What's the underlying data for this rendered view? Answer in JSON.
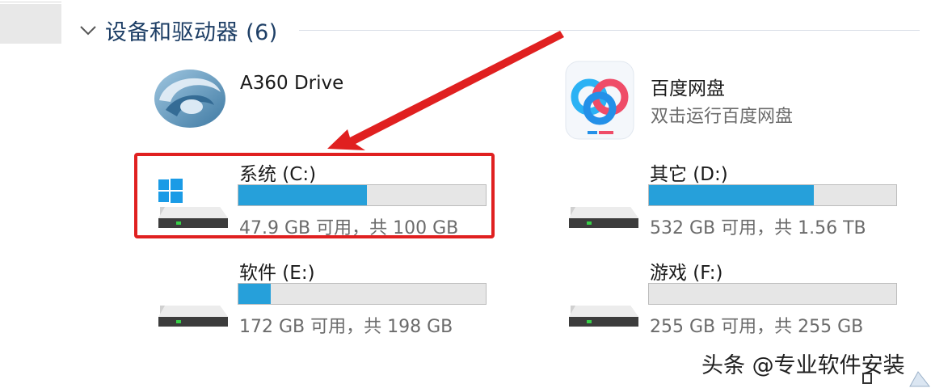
{
  "section": {
    "title": "设备和驱动器 (6)"
  },
  "apps": [
    {
      "name": "A360 Drive",
      "subtitle": ""
    },
    {
      "name": "百度网盘",
      "subtitle": "双击运行百度网盘"
    }
  ],
  "drives": [
    {
      "name": "系统 (C:)",
      "usage": "47.9 GB 可用，共 100 GB",
      "used_fraction": 0.521,
      "icon": "windows-drive-icon"
    },
    {
      "name": "其它 (D:)",
      "usage": "532 GB 可用，共 1.56 TB",
      "used_fraction": 0.667,
      "icon": "hard-drive-icon"
    },
    {
      "name": "软件 (E:)",
      "usage": "172 GB 可用，共 198 GB",
      "used_fraction": 0.131,
      "icon": "hard-drive-icon"
    },
    {
      "name": "游戏 (F:)",
      "usage": "255 GB 可用，共 255 GB",
      "used_fraction": 0.0,
      "icon": "hard-drive-icon"
    }
  ],
  "watermark": "头条 @专业软件安装",
  "colors": {
    "bar_fill": "#26a0da",
    "bar_track": "#e6e6e6",
    "highlight": "#e02020",
    "header_text": "#1e3f66"
  }
}
